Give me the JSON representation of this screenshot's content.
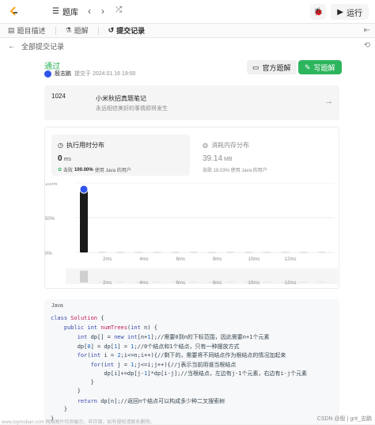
{
  "header": {
    "problems_label": "题库",
    "run_label": "运行"
  },
  "tabs": [
    {
      "label": "题目描述",
      "icon": "doc-icon"
    },
    {
      "label": "题解",
      "icon": "flask-icon"
    },
    {
      "label": "提交记录",
      "icon": "history-icon",
      "active": true
    }
  ],
  "back_label": "全部提交记录",
  "submission": {
    "status": "通过",
    "author": "殷志鹏",
    "submitted_at": "提交于 2024.01.16 19:00",
    "official_solution_label": "官方题解",
    "write_solution_label": "写题解"
  },
  "notes": {
    "id": "1024",
    "title": "小米秋招真题笔记",
    "subtitle": "永远相信美好的事情即将发生"
  },
  "runtime": {
    "title": "执行用时分布",
    "value": "0",
    "unit": "ms",
    "beat_label": "击败",
    "beat_value": "100.00%",
    "beat_suffix": "使用 Java 的用户"
  },
  "memory": {
    "title": "消耗内存分布",
    "value": "39.14",
    "unit": "MB",
    "beat_text": "击败 18.03% 使用 Java 的用户"
  },
  "chart_data": {
    "type": "bar",
    "y_ticks": [
      "100%",
      "50%",
      "0%"
    ],
    "ylim": [
      0,
      100
    ],
    "x_tick_labels": [
      "2ms",
      "4ms",
      "6ms",
      "8ms",
      "10ms",
      "12ms"
    ],
    "bars": [
      {
        "x": 0,
        "value": 93,
        "highlight": true
      },
      {
        "x": 1,
        "value": 1
      },
      {
        "x": 2,
        "value": 1
      },
      {
        "x": 3,
        "value": 1
      },
      {
        "x": 4,
        "value": 1
      },
      {
        "x": 5,
        "value": 1
      },
      {
        "x": 6,
        "value": 1
      },
      {
        "x": 7,
        "value": 1
      },
      {
        "x": 8,
        "value": 1
      },
      {
        "x": 9,
        "value": 1
      },
      {
        "x": 10,
        "value": 1
      },
      {
        "x": 11,
        "value": 1
      },
      {
        "x": 12,
        "value": 1
      },
      {
        "x": 13,
        "value": 1
      }
    ],
    "minimap_labels": [
      "2ms",
      "4ms",
      "6ms",
      "8ms",
      "10ms",
      "12ms"
    ]
  },
  "code": {
    "language": "Java",
    "lines": [
      "class Solution {",
      "    public int numTrees(int n) {",
      "        int dp[] = new int[n+1];//需要0到n的下标范围，因此需要n+1个元素",
      "        dp[0] = dp[1] = 1;//0个结点和1个结点，只有一种摆放方式",
      "        for(int i = 2;i<=n;i++){//剩下的，需要将不同结点作为根结点的情况加起来",
      "            for(int j = 1;j<=i;j++){//j表示当前用谁当根结点",
      "                dp[i]+=dp[j-1]*dp[i-j];//当根结点，左边有j-1个元素，右边有i-j个元素",
      "            }",
      "        }",
      "        return dp[n];//返回n个结点可以构成多少种二叉搜索树",
      "    }",
      "}"
    ]
  },
  "watermark": {
    "left": "www.toymoban.com 网络图片仅供展示，非存储，如有侵权请联系删除。",
    "right": "CSDN @殷 | grit_志鹏"
  }
}
